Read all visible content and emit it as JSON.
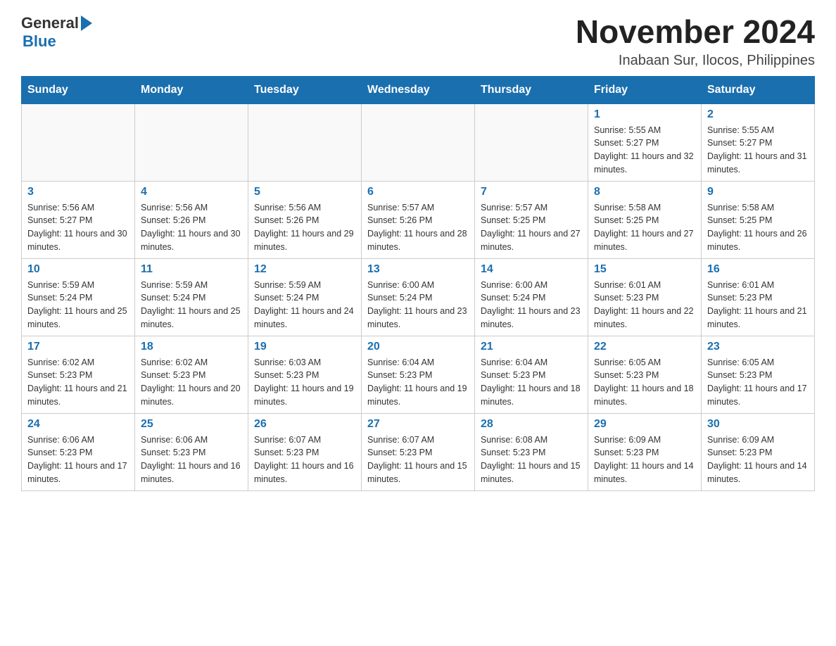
{
  "header": {
    "logo_general": "General",
    "logo_blue": "Blue",
    "month_title": "November 2024",
    "location": "Inabaan Sur, Ilocos, Philippines"
  },
  "days_of_week": [
    "Sunday",
    "Monday",
    "Tuesday",
    "Wednesday",
    "Thursday",
    "Friday",
    "Saturday"
  ],
  "weeks": [
    [
      {
        "day": "",
        "info": ""
      },
      {
        "day": "",
        "info": ""
      },
      {
        "day": "",
        "info": ""
      },
      {
        "day": "",
        "info": ""
      },
      {
        "day": "",
        "info": ""
      },
      {
        "day": "1",
        "info": "Sunrise: 5:55 AM\nSunset: 5:27 PM\nDaylight: 11 hours and 32 minutes."
      },
      {
        "day": "2",
        "info": "Sunrise: 5:55 AM\nSunset: 5:27 PM\nDaylight: 11 hours and 31 minutes."
      }
    ],
    [
      {
        "day": "3",
        "info": "Sunrise: 5:56 AM\nSunset: 5:27 PM\nDaylight: 11 hours and 30 minutes."
      },
      {
        "day": "4",
        "info": "Sunrise: 5:56 AM\nSunset: 5:26 PM\nDaylight: 11 hours and 30 minutes."
      },
      {
        "day": "5",
        "info": "Sunrise: 5:56 AM\nSunset: 5:26 PM\nDaylight: 11 hours and 29 minutes."
      },
      {
        "day": "6",
        "info": "Sunrise: 5:57 AM\nSunset: 5:26 PM\nDaylight: 11 hours and 28 minutes."
      },
      {
        "day": "7",
        "info": "Sunrise: 5:57 AM\nSunset: 5:25 PM\nDaylight: 11 hours and 27 minutes."
      },
      {
        "day": "8",
        "info": "Sunrise: 5:58 AM\nSunset: 5:25 PM\nDaylight: 11 hours and 27 minutes."
      },
      {
        "day": "9",
        "info": "Sunrise: 5:58 AM\nSunset: 5:25 PM\nDaylight: 11 hours and 26 minutes."
      }
    ],
    [
      {
        "day": "10",
        "info": "Sunrise: 5:59 AM\nSunset: 5:24 PM\nDaylight: 11 hours and 25 minutes."
      },
      {
        "day": "11",
        "info": "Sunrise: 5:59 AM\nSunset: 5:24 PM\nDaylight: 11 hours and 25 minutes."
      },
      {
        "day": "12",
        "info": "Sunrise: 5:59 AM\nSunset: 5:24 PM\nDaylight: 11 hours and 24 minutes."
      },
      {
        "day": "13",
        "info": "Sunrise: 6:00 AM\nSunset: 5:24 PM\nDaylight: 11 hours and 23 minutes."
      },
      {
        "day": "14",
        "info": "Sunrise: 6:00 AM\nSunset: 5:24 PM\nDaylight: 11 hours and 23 minutes."
      },
      {
        "day": "15",
        "info": "Sunrise: 6:01 AM\nSunset: 5:23 PM\nDaylight: 11 hours and 22 minutes."
      },
      {
        "day": "16",
        "info": "Sunrise: 6:01 AM\nSunset: 5:23 PM\nDaylight: 11 hours and 21 minutes."
      }
    ],
    [
      {
        "day": "17",
        "info": "Sunrise: 6:02 AM\nSunset: 5:23 PM\nDaylight: 11 hours and 21 minutes."
      },
      {
        "day": "18",
        "info": "Sunrise: 6:02 AM\nSunset: 5:23 PM\nDaylight: 11 hours and 20 minutes."
      },
      {
        "day": "19",
        "info": "Sunrise: 6:03 AM\nSunset: 5:23 PM\nDaylight: 11 hours and 19 minutes."
      },
      {
        "day": "20",
        "info": "Sunrise: 6:04 AM\nSunset: 5:23 PM\nDaylight: 11 hours and 19 minutes."
      },
      {
        "day": "21",
        "info": "Sunrise: 6:04 AM\nSunset: 5:23 PM\nDaylight: 11 hours and 18 minutes."
      },
      {
        "day": "22",
        "info": "Sunrise: 6:05 AM\nSunset: 5:23 PM\nDaylight: 11 hours and 18 minutes."
      },
      {
        "day": "23",
        "info": "Sunrise: 6:05 AM\nSunset: 5:23 PM\nDaylight: 11 hours and 17 minutes."
      }
    ],
    [
      {
        "day": "24",
        "info": "Sunrise: 6:06 AM\nSunset: 5:23 PM\nDaylight: 11 hours and 17 minutes."
      },
      {
        "day": "25",
        "info": "Sunrise: 6:06 AM\nSunset: 5:23 PM\nDaylight: 11 hours and 16 minutes."
      },
      {
        "day": "26",
        "info": "Sunrise: 6:07 AM\nSunset: 5:23 PM\nDaylight: 11 hours and 16 minutes."
      },
      {
        "day": "27",
        "info": "Sunrise: 6:07 AM\nSunset: 5:23 PM\nDaylight: 11 hours and 15 minutes."
      },
      {
        "day": "28",
        "info": "Sunrise: 6:08 AM\nSunset: 5:23 PM\nDaylight: 11 hours and 15 minutes."
      },
      {
        "day": "29",
        "info": "Sunrise: 6:09 AM\nSunset: 5:23 PM\nDaylight: 11 hours and 14 minutes."
      },
      {
        "day": "30",
        "info": "Sunrise: 6:09 AM\nSunset: 5:23 PM\nDaylight: 11 hours and 14 minutes."
      }
    ]
  ]
}
